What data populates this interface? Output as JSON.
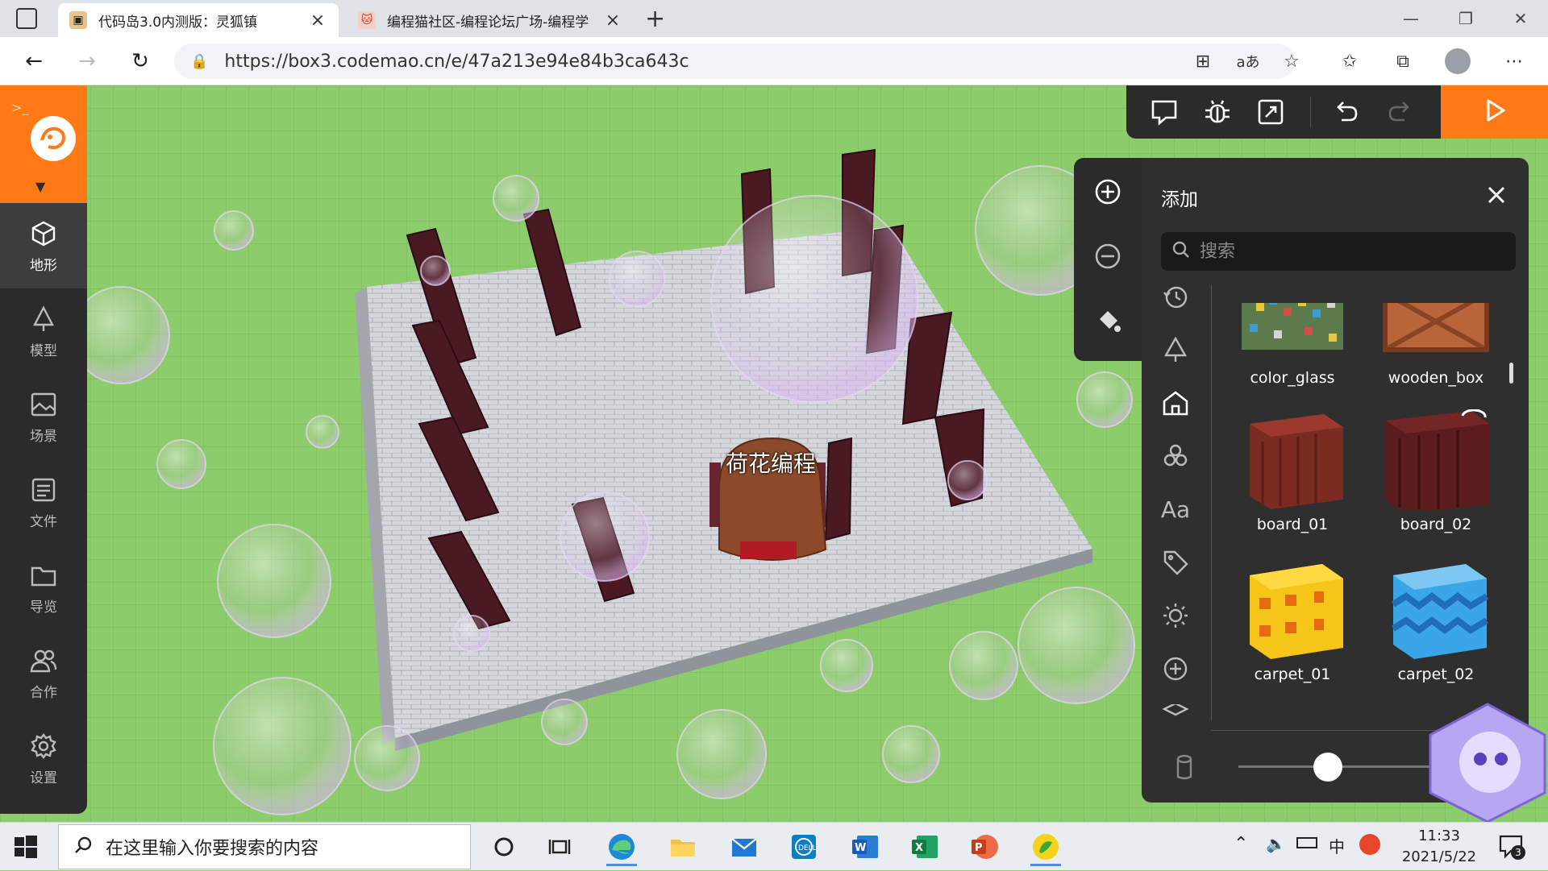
{
  "browser": {
    "tabs": [
      {
        "title": "代码岛3.0内测版：灵狐镇",
        "active": true
      },
      {
        "title": "编程猫社区-编程论坛广场-编程学",
        "active": false
      }
    ],
    "url": "https://box3.codemao.cn/e/47a213e94e84b3ca643c"
  },
  "sidebar": {
    "items": [
      {
        "label": "地形",
        "icon": "cube-icon",
        "active": true
      },
      {
        "label": "模型",
        "icon": "tree-icon",
        "active": false
      },
      {
        "label": "场景",
        "icon": "image-icon",
        "active": false
      },
      {
        "label": "文件",
        "icon": "file-list-icon",
        "active": false
      },
      {
        "label": "导览",
        "icon": "folder-icon",
        "active": false
      },
      {
        "label": "合作",
        "icon": "users-icon",
        "active": false
      },
      {
        "label": "设置",
        "icon": "gear-icon",
        "active": false
      }
    ]
  },
  "scene": {
    "player_label": "荷花编程"
  },
  "add_panel": {
    "title": "添加",
    "search_placeholder": "搜索",
    "categories": [
      "history-icon",
      "tree-icon",
      "home-icon",
      "cluster-icon",
      "text-icon",
      "tag-icon",
      "sun-icon",
      "plus-circle-icon",
      "layers-icon"
    ],
    "items": [
      {
        "name": "color_glass",
        "color": "#6b8f5a"
      },
      {
        "name": "wooden_box",
        "color": "#b8653a"
      },
      {
        "name": "board_01",
        "color": "#7a2b22"
      },
      {
        "name": "board_02",
        "color": "#5a1c1c"
      },
      {
        "name": "carpet_01",
        "color": "#f5c518"
      },
      {
        "name": "carpet_02",
        "color": "#3aa6e8"
      }
    ],
    "slider_value": 0.37
  },
  "taskbar": {
    "search_placeholder": "在这里输入你要搜索的内容",
    "time": "11:33",
    "date": "2021/5/22",
    "notification_count": "3",
    "ime": "中"
  },
  "colors": {
    "accent": "#ff7a16",
    "panel": "#2b2b2b",
    "grass": "#89c968"
  }
}
